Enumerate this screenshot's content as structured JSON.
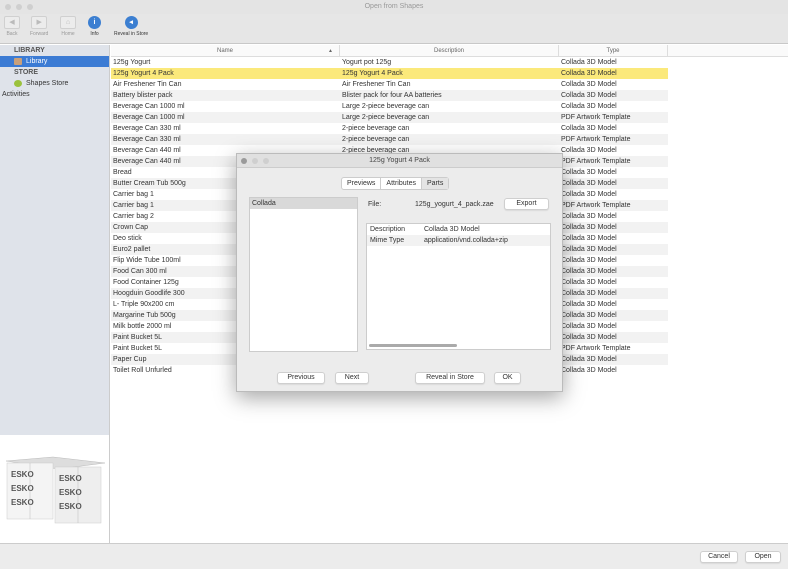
{
  "window": {
    "title": "Open from Shapes"
  },
  "toolbar": [
    {
      "label": "Back",
      "icon": "back-icon",
      "glyph": "◀",
      "enabled": false
    },
    {
      "label": "Forward",
      "icon": "forward-icon",
      "glyph": "▶",
      "enabled": false
    },
    {
      "label": "Home",
      "icon": "home-icon",
      "glyph": "⌂",
      "enabled": false
    },
    {
      "label": "Info",
      "icon": "info-icon",
      "glyph": "i",
      "enabled": true
    },
    {
      "label": "Reveal in Store",
      "icon": "reveal-icon",
      "glyph": "◂",
      "enabled": true
    }
  ],
  "sidebar": {
    "library_header": "LIBRARY",
    "library_item": "Library",
    "store_header": "STORE",
    "store_item": "Shapes Store",
    "activities": "Activities"
  },
  "table": {
    "columns": [
      "Name",
      "Description",
      "Type"
    ],
    "sort_indicator": "▲",
    "selected_index": 1,
    "rows": [
      {
        "name": "125g Yogurt",
        "description": "Yogurt pot 125g",
        "type": "Collada 3D Model"
      },
      {
        "name": "125g Yogurt 4 Pack",
        "description": "125g Yogurt 4 Pack",
        "type": "Collada 3D Model"
      },
      {
        "name": "Air Freshener Tin Can",
        "description": "Air Freshener Tin Can",
        "type": "Collada 3D Model"
      },
      {
        "name": "Battery blister pack",
        "description": "Blister pack for four AA batteries",
        "type": "Collada 3D Model"
      },
      {
        "name": "Beverage Can 1000 ml",
        "description": "Large 2-piece beverage can",
        "type": "Collada 3D Model"
      },
      {
        "name": "Beverage Can 1000 ml",
        "description": "Large 2-piece beverage can",
        "type": "PDF Artwork Template"
      },
      {
        "name": "Beverage Can 330 ml",
        "description": "2-piece beverage can",
        "type": "Collada 3D Model"
      },
      {
        "name": "Beverage Can 330 ml",
        "description": "2-piece beverage can",
        "type": "PDF Artwork Template"
      },
      {
        "name": "Beverage Can 440 ml",
        "description": "2-piece beverage can",
        "type": "Collada 3D Model"
      },
      {
        "name": "Beverage Can 440 ml",
        "description": "",
        "type": "PDF Artwork Template"
      },
      {
        "name": "Bread",
        "description": "",
        "type": "Collada 3D Model"
      },
      {
        "name": "Butter Cream Tub 500g",
        "description": "",
        "type": "Collada 3D Model"
      },
      {
        "name": "Carrier bag 1",
        "description": "",
        "type": "Collada 3D Model"
      },
      {
        "name": "Carrier bag 1",
        "description": "",
        "type": "PDF Artwork Template"
      },
      {
        "name": "Carrier bag 2",
        "description": "",
        "type": "Collada 3D Model"
      },
      {
        "name": "Crown Cap",
        "description": "",
        "type": "Collada 3D Model"
      },
      {
        "name": "Deo stick",
        "description": "",
        "type": "Collada 3D Model"
      },
      {
        "name": "Euro2 pallet",
        "description": "",
        "type": "Collada 3D Model"
      },
      {
        "name": "Flip Wide Tube 100ml",
        "description": "",
        "type": "Collada 3D Model"
      },
      {
        "name": "Food Can 300 ml",
        "description": "",
        "type": "Collada 3D Model"
      },
      {
        "name": "Food Container 125g",
        "description": "",
        "type": "Collada 3D Model"
      },
      {
        "name": "Hoogduin Goodlife 300",
        "description": "",
        "type": "Collada 3D Model"
      },
      {
        "name": "L- Triple 90x200 cm",
        "description": "",
        "type": "Collada 3D Model"
      },
      {
        "name": "Margarine Tub 500g",
        "description": "",
        "type": "Collada 3D Model"
      },
      {
        "name": "Milk bottle 2000 ml",
        "description": "",
        "type": "Collada 3D Model"
      },
      {
        "name": "Paint Bucket 5L",
        "description": "",
        "type": "Collada 3D Model"
      },
      {
        "name": "Paint Bucket 5L",
        "description": "",
        "type": "PDF Artwork Template"
      },
      {
        "name": "Paper Cup",
        "description": "",
        "type": "Collada 3D Model"
      },
      {
        "name": "Toilet Roll Unfurled",
        "description": "",
        "type": "Collada 3D Model"
      }
    ]
  },
  "dialog": {
    "title": "125g Yogurt 4 Pack",
    "tabs": [
      "Previews",
      "Attributes",
      "Parts"
    ],
    "active_tab": 2,
    "parts": [
      "Collada"
    ],
    "file_label": "File:",
    "file_name": "125g_yogurt_4_pack.zae",
    "export_label": "Export",
    "attributes": [
      {
        "key": "Description",
        "value": "Collada 3D Model"
      },
      {
        "key": "Mime Type",
        "value": "application/vnd.collada+zip"
      }
    ],
    "previous_label": "Previous",
    "next_label": "Next",
    "reveal_label": "Reveal in Store",
    "ok_label": "OK"
  },
  "footer": {
    "cancel_label": "Cancel",
    "open_label": "Open"
  }
}
